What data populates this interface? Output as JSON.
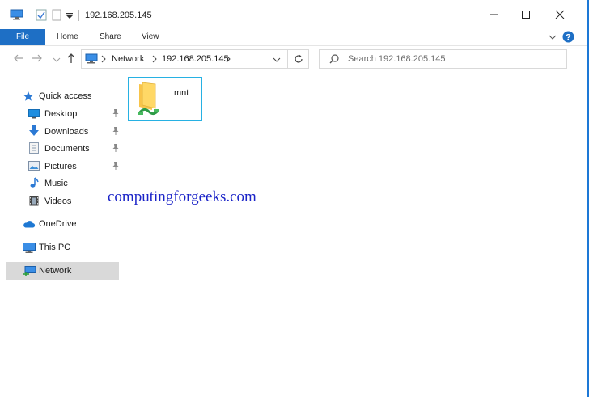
{
  "window": {
    "title": "192.168.205.145"
  },
  "ribbon": {
    "tabs": [
      "File",
      "Home",
      "Share",
      "View"
    ]
  },
  "address": {
    "crumbs": [
      "Network",
      "192.168.205.145"
    ]
  },
  "search": {
    "placeholder": "Search 192.168.205.145"
  },
  "sidebar": {
    "quick_access": "Quick access",
    "items": [
      "Desktop",
      "Downloads",
      "Documents",
      "Pictures",
      "Music",
      "Videos"
    ],
    "onedrive": "OneDrive",
    "thispc": "This PC",
    "network": "Network"
  },
  "content": {
    "folder_name": "mnt"
  },
  "watermark": "computingforgeeks.com",
  "colors": {
    "accent": "#1e6fc5",
    "selection": "#d9d9d9",
    "tile_border": "#27b1e3"
  }
}
